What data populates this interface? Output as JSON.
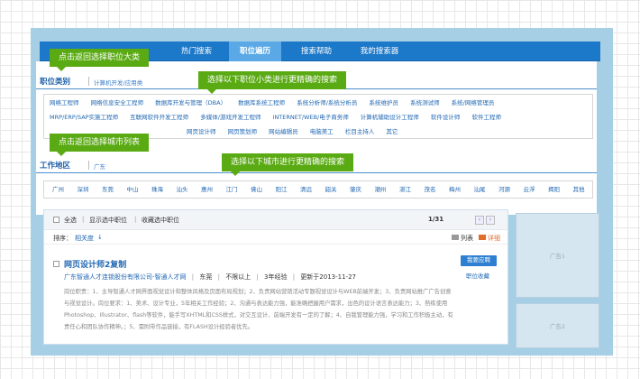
{
  "nav": {
    "tabs": [
      "热门搜索",
      "职位遍历",
      "搜索帮助",
      "我的搜索器"
    ],
    "active_tab": "职位遍历"
  },
  "tips": {
    "job_category": "点击返回选择职位大类",
    "job_subcategory": "选择以下职位小类进行更精确的搜索",
    "city_list": "点击返回选择城市列表",
    "city_select": "选择以下城市进行更精确的搜索"
  },
  "job_section": {
    "title": "职位类别",
    "current": "计算机开发/应用类",
    "row1": [
      "网络工程师",
      "网络信息安全工程师",
      "数据库开发与管理（DBA）",
      "数据库系统工程师",
      "系统分析师/系统分析员",
      "系统维护员",
      "系统测试师",
      "系统/网络管理员"
    ],
    "row2": [
      "MRP/ERP/SAP实施工程师",
      "互联网软件开发工程师",
      "多媒体/游戏开发工程师",
      "INTERNET/WEB/电子商务师",
      "计算机辅助设计工程师",
      "软件设计师",
      "软件工程师"
    ],
    "row3": [
      "网页设计师",
      "网页策划师",
      "网站编辑员",
      "电脑美工",
      "栏目主持人",
      "其它"
    ]
  },
  "city_section": {
    "title": "工作地区",
    "current": "广东",
    "cities": [
      "广州",
      "深圳",
      "东莞",
      "中山",
      "珠海",
      "汕头",
      "惠州",
      "江门",
      "佛山",
      "阳江",
      "清远",
      "韶关",
      "肇庆",
      "潮州",
      "湛江",
      "茂名",
      "梅州",
      "汕尾",
      "河源",
      "云浮",
      "揭阳",
      "其他"
    ]
  },
  "results": {
    "select_all": "全选",
    "show_selected": "显示选中职位",
    "save_selected": "收藏选中职位",
    "sep": "|",
    "page": "1/31",
    "sort_label": "排序：",
    "sort_value": "相关度",
    "view_list": "列表",
    "view_detail": "详细",
    "job": {
      "title": "网页设计师2复制",
      "company": "广东智通人才连锁股份有限公司-智通人才网",
      "location": "东莞",
      "salary": "不限以上",
      "experience": "3年经验",
      "updated": "更新于2013-11-27",
      "apply": "我要应聘",
      "save": "职位收藏",
      "description": "岗位职责：1、主导智通人才网界面视觉设计和整体风格及页面布局规划；2、负责网站营销活动专题视觉设计与WEB前端开发；3、负责网站推广广告创意与视觉设计。岗位要求：1、美术、设计专业，5年相关工作经验；2、沟通与表达能力强，能准确把握用户需求，出色的设计语言表达能力；3、熟练使用Photoshop、Illustrator、flash等软件，能手写XHTML和CSS样式，对交互设计、前端开发有一定的了解；4、自我管理能力强，学习和工作积极主动，有责任心和团队协作精神。；5、需附带作品链接，有FLASH设计经验者优先。"
    }
  },
  "ads": [
    "广告1",
    "广告2"
  ]
}
